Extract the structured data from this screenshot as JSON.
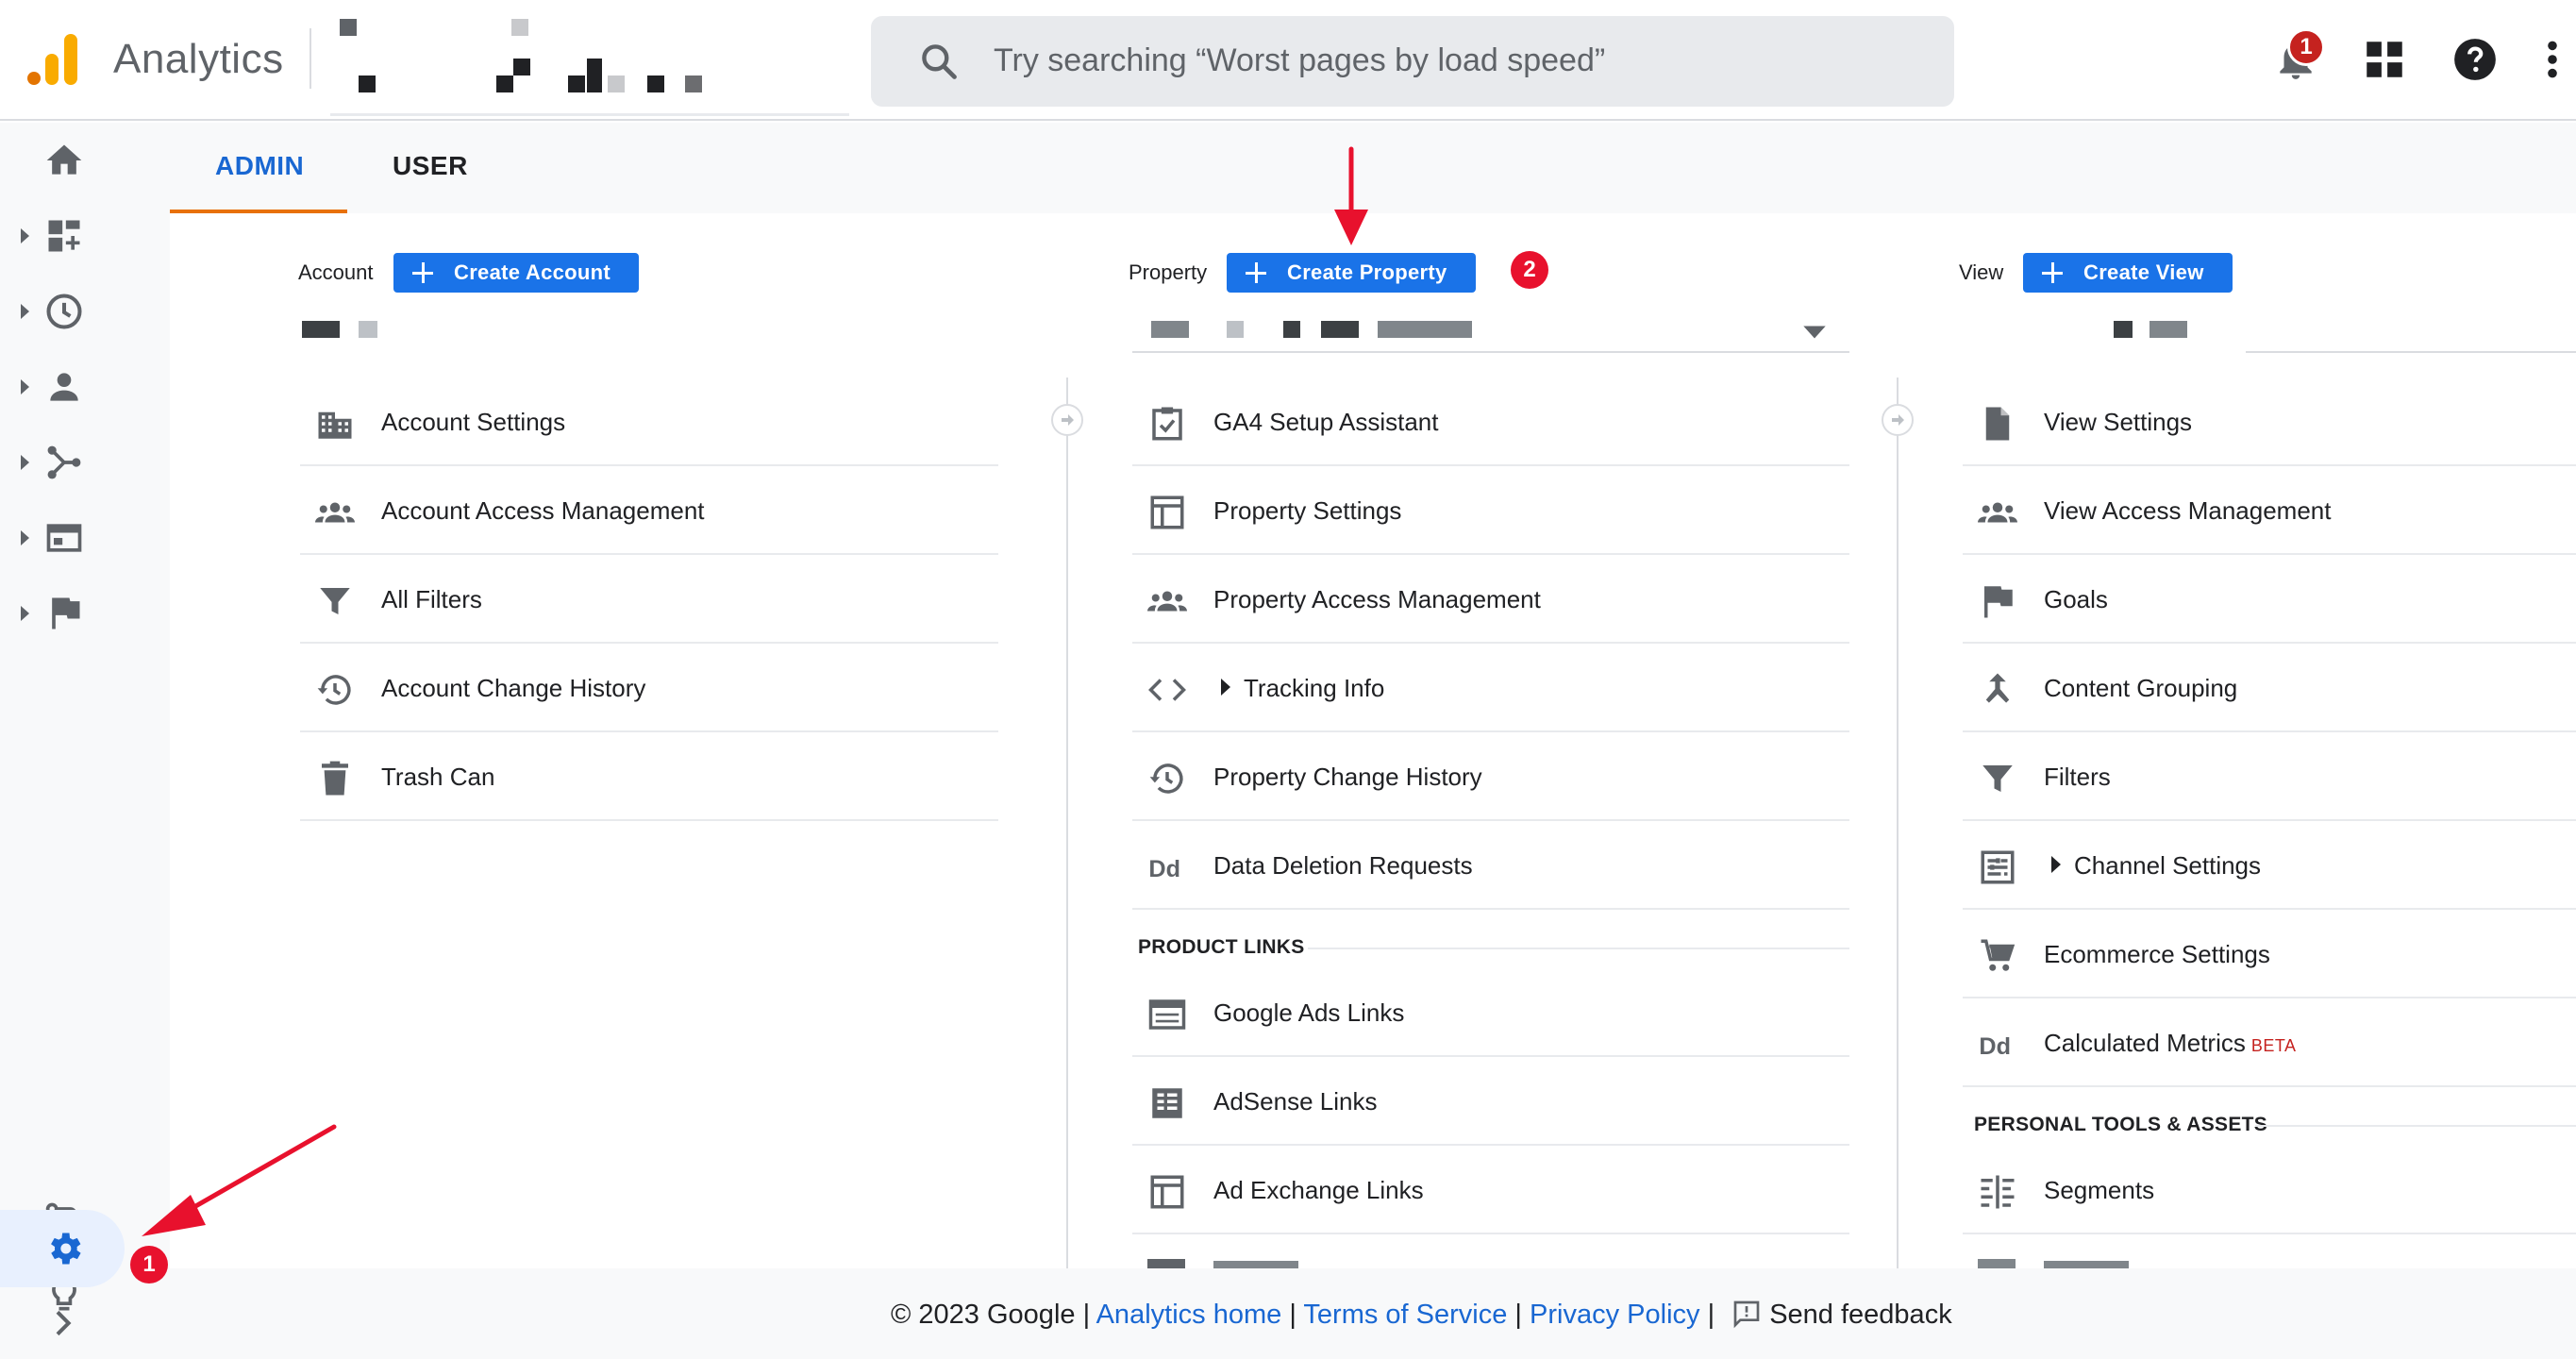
{
  "header": {
    "app_name": "Analytics",
    "search_placeholder": "Try searching “Worst pages by load speed”",
    "notification_count": "1",
    "icons": [
      "analytics-logo-icon",
      "search-icon",
      "bell-icon",
      "apps-grid-icon",
      "help-icon",
      "more-vert-icon"
    ]
  },
  "nav_rail": {
    "items": [
      "home-icon",
      "customization-icon",
      "realtime-icon",
      "audience-icon",
      "acquisition-icon",
      "behavior-icon",
      "conversions-icon"
    ],
    "bottom": [
      "attribution-icon",
      "insights-icon",
      "admin-gear-icon",
      "expand-icon"
    ]
  },
  "tabs": [
    {
      "label": "ADMIN",
      "active": true
    },
    {
      "label": "USER",
      "active": false
    }
  ],
  "columns": {
    "account": {
      "label": "Account",
      "create_button": "Create Account",
      "items": [
        {
          "icon": "building-icon",
          "label": "Account Settings"
        },
        {
          "icon": "people-icon",
          "label": "Account Access Management"
        },
        {
          "icon": "filter-icon",
          "label": "All Filters"
        },
        {
          "icon": "history-icon",
          "label": "Account Change History"
        },
        {
          "icon": "trash-icon",
          "label": "Trash Can"
        }
      ]
    },
    "property": {
      "label": "Property",
      "create_button": "Create Property",
      "items": [
        {
          "icon": "checklist-icon",
          "label": "GA4 Setup Assistant"
        },
        {
          "icon": "layout-icon",
          "label": "Property Settings"
        },
        {
          "icon": "people-icon",
          "label": "Property Access Management"
        },
        {
          "icon": "code-icon",
          "label": "Tracking Info",
          "expandable": true
        },
        {
          "icon": "history-icon",
          "label": "Property Change History"
        },
        {
          "icon": "dd-icon",
          "label": "Data Deletion Requests"
        }
      ],
      "section_title": "PRODUCT LINKS",
      "section_items": [
        {
          "icon": "ads-icon",
          "label": "Google Ads Links"
        },
        {
          "icon": "adsense-icon",
          "label": "AdSense Links"
        },
        {
          "icon": "layout-icon",
          "label": "Ad Exchange Links"
        }
      ]
    },
    "view": {
      "label": "View",
      "create_button": "Create View",
      "items": [
        {
          "icon": "document-icon",
          "label": "View Settings"
        },
        {
          "icon": "people-icon",
          "label": "View Access Management"
        },
        {
          "icon": "flag-icon",
          "label": "Goals"
        },
        {
          "icon": "merge-icon",
          "label": "Content Grouping"
        },
        {
          "icon": "filter-icon",
          "label": "Filters"
        },
        {
          "icon": "channel-icon",
          "label": "Channel Settings",
          "expandable": true
        },
        {
          "icon": "cart-icon",
          "label": "Ecommerce Settings"
        },
        {
          "icon": "dd-icon",
          "label": "Calculated Metrics",
          "badge": "BETA"
        }
      ],
      "section_title": "PERSONAL TOOLS & ASSETS",
      "section_items": [
        {
          "icon": "segments-icon",
          "label": "Segments"
        }
      ]
    }
  },
  "footer": {
    "copyright": "© 2023 Google",
    "sep": "|",
    "links": [
      "Analytics home",
      "Terms of Service",
      "Privacy Policy"
    ],
    "feedback": "Send feedback"
  },
  "annotations": {
    "step1": "1",
    "step2": "2"
  },
  "colors": {
    "accent_blue": "#1a73e8",
    "tab_active": "#1967d2",
    "tab_underline": "#e8710a",
    "annotation_red": "#e8112d",
    "logo_orange": "#f9ab00",
    "logo_dark_orange": "#e37400"
  }
}
